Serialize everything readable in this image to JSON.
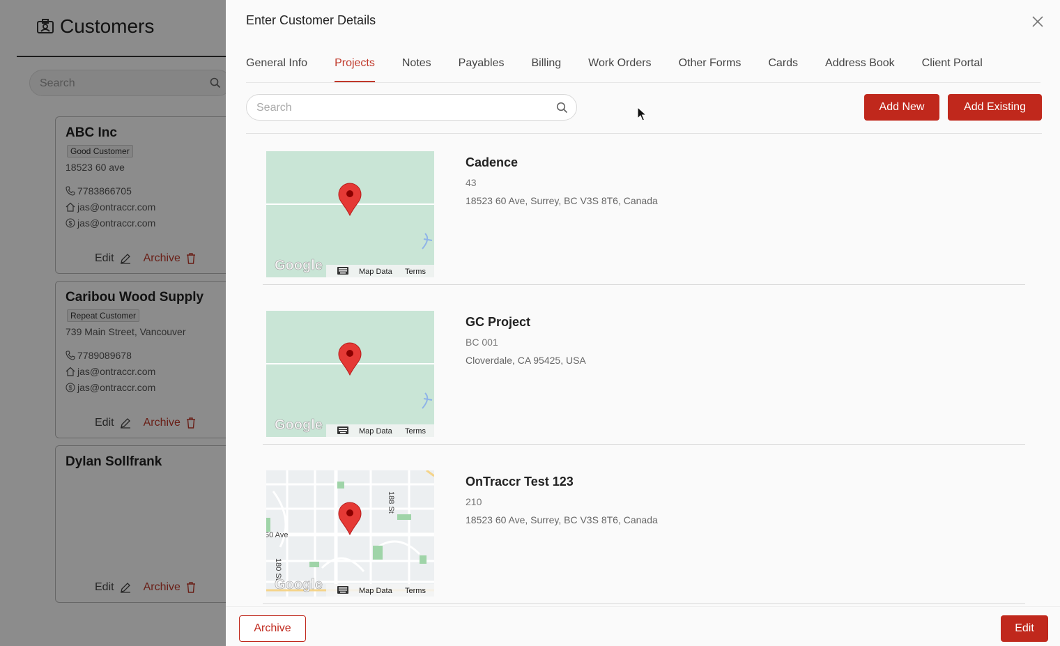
{
  "background": {
    "title": "Customers",
    "search_placeholder": "Search",
    "customers": [
      {
        "name": "ABC Inc",
        "badge": "Good Customer",
        "address": "18523 60 ave",
        "phone": "7783866705",
        "email1": "jas@ontraccr.com",
        "email2": "jas@ontraccr.com",
        "edit": "Edit",
        "archive": "Archive"
      },
      {
        "name": "Caribou Wood Supply",
        "badge": "Repeat Customer",
        "address": "739 Main Street, Vancouver",
        "phone": "7789089678",
        "email1": "jas@ontraccr.com",
        "email2": "jas@ontraccr.com",
        "edit": "Edit",
        "archive": "Archive"
      },
      {
        "name": "Dylan Sollfrank",
        "edit": "Edit",
        "archive": "Archive"
      }
    ]
  },
  "drawer": {
    "title": "Enter Customer Details",
    "tabs": [
      {
        "label": "General Info"
      },
      {
        "label": "Projects"
      },
      {
        "label": "Notes"
      },
      {
        "label": "Payables"
      },
      {
        "label": "Billing"
      },
      {
        "label": "Work Orders"
      },
      {
        "label": "Other Forms"
      },
      {
        "label": "Cards"
      },
      {
        "label": "Address Book"
      },
      {
        "label": "Client Portal"
      }
    ],
    "active_tab": "Projects",
    "search_placeholder": "Search",
    "add_new_label": "Add New",
    "add_existing_label": "Add Existing",
    "projects": [
      {
        "name": "Cadence",
        "number": "43",
        "address": "18523 60 Ave, Surrey, BC V3S 8T6, Canada"
      },
      {
        "name": "GC Project",
        "number": "BC 001",
        "address": "Cloverdale, CA 95425, USA"
      },
      {
        "name": "OnTraccr Test 123",
        "number": "210",
        "address": "18523 60 Ave, Surrey, BC V3S 8T6, Canada"
      }
    ],
    "map": {
      "brand": "Google",
      "map_data": "Map Data",
      "terms": "Terms",
      "street1": "188 St",
      "street2": "60 Ave",
      "street3": "180 St"
    },
    "footer": {
      "archive_label": "Archive",
      "edit_label": "Edit"
    }
  },
  "colors": {
    "accent": "#c0281c",
    "map_green": "#c9e5d6",
    "pin": "#e53935"
  }
}
